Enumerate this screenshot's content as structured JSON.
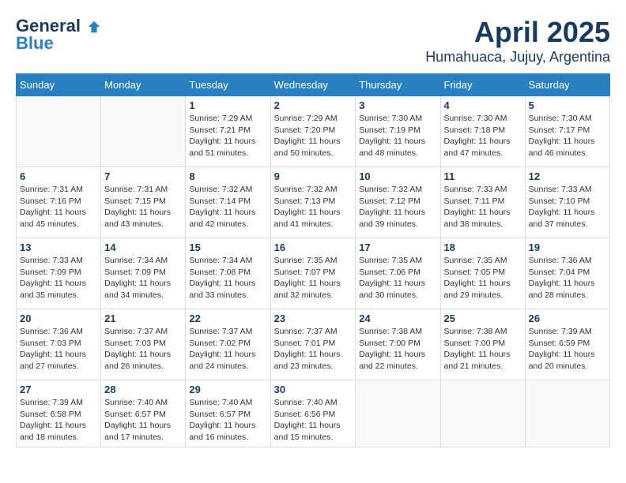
{
  "header": {
    "logo_general": "General",
    "logo_blue": "Blue",
    "month": "April 2025",
    "location": "Humahuaca, Jujuy, Argentina"
  },
  "weekdays": [
    "Sunday",
    "Monday",
    "Tuesday",
    "Wednesday",
    "Thursday",
    "Friday",
    "Saturday"
  ],
  "weeks": [
    [
      {
        "day": "",
        "info": ""
      },
      {
        "day": "",
        "info": ""
      },
      {
        "day": "1",
        "info": "Sunrise: 7:29 AM\nSunset: 7:21 PM\nDaylight: 11 hours and 51 minutes."
      },
      {
        "day": "2",
        "info": "Sunrise: 7:29 AM\nSunset: 7:20 PM\nDaylight: 11 hours and 50 minutes."
      },
      {
        "day": "3",
        "info": "Sunrise: 7:30 AM\nSunset: 7:19 PM\nDaylight: 11 hours and 48 minutes."
      },
      {
        "day": "4",
        "info": "Sunrise: 7:30 AM\nSunset: 7:18 PM\nDaylight: 11 hours and 47 minutes."
      },
      {
        "day": "5",
        "info": "Sunrise: 7:30 AM\nSunset: 7:17 PM\nDaylight: 11 hours and 46 minutes."
      }
    ],
    [
      {
        "day": "6",
        "info": "Sunrise: 7:31 AM\nSunset: 7:16 PM\nDaylight: 11 hours and 45 minutes."
      },
      {
        "day": "7",
        "info": "Sunrise: 7:31 AM\nSunset: 7:15 PM\nDaylight: 11 hours and 43 minutes."
      },
      {
        "day": "8",
        "info": "Sunrise: 7:32 AM\nSunset: 7:14 PM\nDaylight: 11 hours and 42 minutes."
      },
      {
        "day": "9",
        "info": "Sunrise: 7:32 AM\nSunset: 7:13 PM\nDaylight: 11 hours and 41 minutes."
      },
      {
        "day": "10",
        "info": "Sunrise: 7:32 AM\nSunset: 7:12 PM\nDaylight: 11 hours and 39 minutes."
      },
      {
        "day": "11",
        "info": "Sunrise: 7:33 AM\nSunset: 7:11 PM\nDaylight: 11 hours and 38 minutes."
      },
      {
        "day": "12",
        "info": "Sunrise: 7:33 AM\nSunset: 7:10 PM\nDaylight: 11 hours and 37 minutes."
      }
    ],
    [
      {
        "day": "13",
        "info": "Sunrise: 7:33 AM\nSunset: 7:09 PM\nDaylight: 11 hours and 35 minutes."
      },
      {
        "day": "14",
        "info": "Sunrise: 7:34 AM\nSunset: 7:09 PM\nDaylight: 11 hours and 34 minutes."
      },
      {
        "day": "15",
        "info": "Sunrise: 7:34 AM\nSunset: 7:08 PM\nDaylight: 11 hours and 33 minutes."
      },
      {
        "day": "16",
        "info": "Sunrise: 7:35 AM\nSunset: 7:07 PM\nDaylight: 11 hours and 32 minutes."
      },
      {
        "day": "17",
        "info": "Sunrise: 7:35 AM\nSunset: 7:06 PM\nDaylight: 11 hours and 30 minutes."
      },
      {
        "day": "18",
        "info": "Sunrise: 7:35 AM\nSunset: 7:05 PM\nDaylight: 11 hours and 29 minutes."
      },
      {
        "day": "19",
        "info": "Sunrise: 7:36 AM\nSunset: 7:04 PM\nDaylight: 11 hours and 28 minutes."
      }
    ],
    [
      {
        "day": "20",
        "info": "Sunrise: 7:36 AM\nSunset: 7:03 PM\nDaylight: 11 hours and 27 minutes."
      },
      {
        "day": "21",
        "info": "Sunrise: 7:37 AM\nSunset: 7:03 PM\nDaylight: 11 hours and 26 minutes."
      },
      {
        "day": "22",
        "info": "Sunrise: 7:37 AM\nSunset: 7:02 PM\nDaylight: 11 hours and 24 minutes."
      },
      {
        "day": "23",
        "info": "Sunrise: 7:37 AM\nSunset: 7:01 PM\nDaylight: 11 hours and 23 minutes."
      },
      {
        "day": "24",
        "info": "Sunrise: 7:38 AM\nSunset: 7:00 PM\nDaylight: 11 hours and 22 minutes."
      },
      {
        "day": "25",
        "info": "Sunrise: 7:38 AM\nSunset: 7:00 PM\nDaylight: 11 hours and 21 minutes."
      },
      {
        "day": "26",
        "info": "Sunrise: 7:39 AM\nSunset: 6:59 PM\nDaylight: 11 hours and 20 minutes."
      }
    ],
    [
      {
        "day": "27",
        "info": "Sunrise: 7:39 AM\nSunset: 6:58 PM\nDaylight: 11 hours and 18 minutes."
      },
      {
        "day": "28",
        "info": "Sunrise: 7:40 AM\nSunset: 6:57 PM\nDaylight: 11 hours and 17 minutes."
      },
      {
        "day": "29",
        "info": "Sunrise: 7:40 AM\nSunset: 6:57 PM\nDaylight: 11 hours and 16 minutes."
      },
      {
        "day": "30",
        "info": "Sunrise: 7:40 AM\nSunset: 6:56 PM\nDaylight: 11 hours and 15 minutes."
      },
      {
        "day": "",
        "info": ""
      },
      {
        "day": "",
        "info": ""
      },
      {
        "day": "",
        "info": ""
      }
    ]
  ]
}
